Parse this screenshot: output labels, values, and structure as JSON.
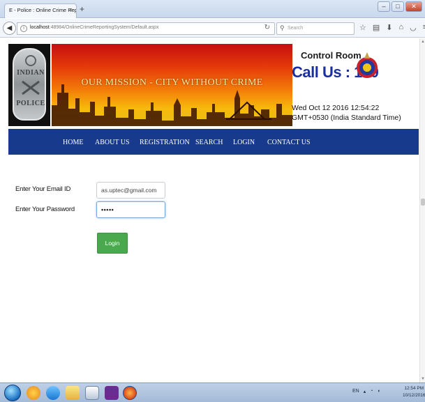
{
  "browser": {
    "tab_title": "E - Police : Online Crime Repor...",
    "tab_close": "×",
    "new_tab": "+",
    "url_host": "localhost",
    "url_rest": ":48984/OnlineCrimeReportingSystem/Default.aspx",
    "search_placeholder": "Search",
    "window_buttons": [
      "–",
      "□",
      "✕"
    ]
  },
  "header": {
    "badge_text_top": "INDIAN",
    "badge_text_bottom": "POLICE",
    "mission": "OUR MISSION - CITY WITHOUT CRIME",
    "control_room": "Control Room",
    "call_us": "Call Us : 100",
    "datetime": "Wed Oct 12 2016 12:54:22 GMT+0530 (India Standard Time)"
  },
  "menu": {
    "items": [
      "HOME",
      "ABOUT US",
      "REGISTRATION",
      "SEARCH",
      "LOGIN",
      "CONTACT US"
    ],
    "color": "#173a8c"
  },
  "form": {
    "email_label": "Enter Your Email ID",
    "email_value": "as.uptec@gmail.com",
    "password_label": "Enter Your Password",
    "password_value": "•••••",
    "login_button": "Login",
    "button_color": "#4aa84f"
  },
  "taskbar": {
    "language": "EN",
    "time": "12:54 PM",
    "date": "10/12/2016"
  }
}
